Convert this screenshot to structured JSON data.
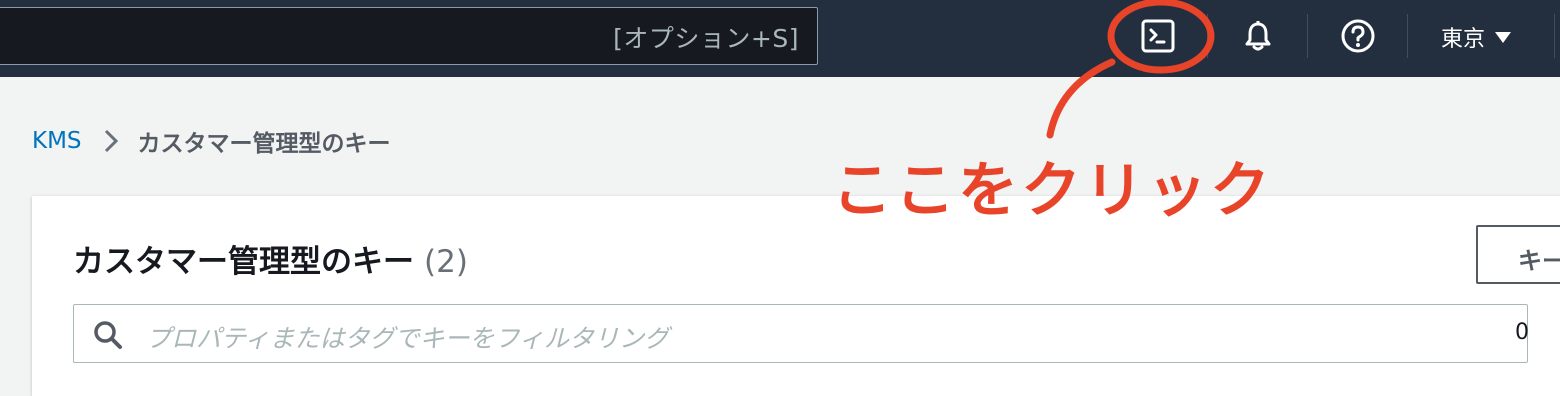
{
  "search": {
    "shortcut": "[オプション+S]"
  },
  "topbar": {
    "cloudshell_icon": "terminal-icon",
    "notifications_icon": "bell-icon",
    "help_icon": "help-icon",
    "region_label": "東京"
  },
  "breadcrumb": {
    "root": "KMS",
    "current": "カスタマー管理型のキー"
  },
  "panel": {
    "title": "カスタマー管理型のキー",
    "count": "(2)",
    "button_label": "キー",
    "filter_placeholder": "プロパティまたはタグでキーをフィルタリング",
    "page_number": "0"
  },
  "annotation": {
    "text": "ここをクリック",
    "color": "#e8442a"
  }
}
